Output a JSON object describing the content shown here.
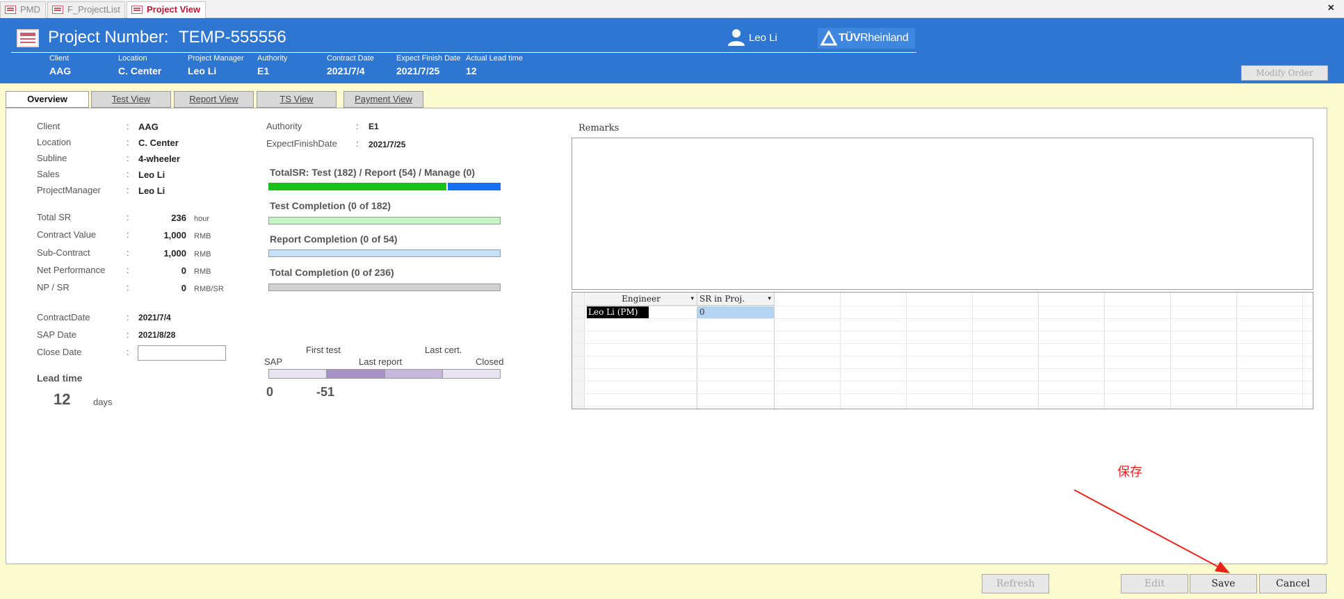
{
  "doc_tabs": [
    {
      "label": "PMD",
      "active": false
    },
    {
      "label": "F_ProjectList",
      "active": false
    },
    {
      "label": "Project View",
      "active": true
    }
  ],
  "window_close": "×",
  "header": {
    "project_label": "Project Number:",
    "project_number": "TEMP-555556",
    "user_name": "Leo Li",
    "logo_text_a": "TÜV",
    "logo_text_b": "Rheinland",
    "info": [
      {
        "label": "Client",
        "value": "AAG"
      },
      {
        "label": "Location",
        "value": "C. Center"
      },
      {
        "label": "Project Manager",
        "value": "Leo Li"
      },
      {
        "label": "Authority",
        "value": "E1"
      },
      {
        "label": "Contract Date",
        "value": "2021/7/4"
      },
      {
        "label": "Expect Finish Date",
        "value": "2021/7/25"
      },
      {
        "label": "Actual Lead time",
        "value": "12"
      }
    ],
    "modify_button": "Modify Order"
  },
  "view_tabs": [
    "Overview",
    "Test View",
    "Report View",
    "TS View",
    "Payment View"
  ],
  "overview": {
    "basic": [
      {
        "label": "Client",
        "value": "AAG"
      },
      {
        "label": "Location",
        "value": "C. Center"
      },
      {
        "label": "Subline",
        "value": "4-wheeler"
      },
      {
        "label": "Sales",
        "value": "Leo Li"
      },
      {
        "label": "ProjectManager",
        "value": "Leo Li"
      }
    ],
    "financial": [
      {
        "label": "Total SR",
        "value": "236",
        "unit": "hour"
      },
      {
        "label": "Contract Value",
        "value": "1,000",
        "unit": "RMB"
      },
      {
        "label": "Sub-Contract",
        "value": "1,000",
        "unit": "RMB"
      },
      {
        "label": "Net Performance",
        "value": "0",
        "unit": "RMB"
      },
      {
        "label": "NP / SR",
        "value": "0",
        "unit": "RMB/SR"
      }
    ],
    "dates": [
      {
        "label": "ContractDate",
        "value": "2021/7/4"
      },
      {
        "label": "SAP Date",
        "value": "2021/8/28"
      },
      {
        "label": "Close Date",
        "value": ""
      }
    ],
    "colon": ":",
    "lead_time_label": "Lead time",
    "lead_time_value": "12",
    "lead_time_unit": "days",
    "authority_label": "Authority",
    "authority_value": "E1",
    "expect_label": "ExpectFinishDate",
    "expect_value": "2021/7/25"
  },
  "progress": {
    "total_sr_title": "TotalSR: Test (182) / Report (54) / Manage (0)",
    "test_share": 0.771,
    "report_share": 0.229,
    "test_title": "Test Completion (0 of 182)",
    "test_fraction": 0,
    "report_title": "Report Completion (0 of 54)",
    "report_fraction": 0,
    "total_title": "Total Completion (0 of 236)",
    "total_fraction": 0,
    "colors": {
      "test": "#19c11c",
      "report": "#1a6ff0",
      "test_bg": "#c6f5c6",
      "report_bg": "#c6e0f5",
      "total_bg": "#d0d0d0"
    }
  },
  "timeline": {
    "first_test": "First test",
    "last_cert": "Last cert.",
    "sap": "SAP",
    "last_report": "Last report",
    "closed": "Closed",
    "value_a": "0",
    "value_b": "-51"
  },
  "remarks": {
    "label": "Remarks",
    "text": ""
  },
  "engineer_grid": {
    "columns": [
      "Engineer",
      "SR in Proj."
    ],
    "rows": [
      {
        "engineer": "Leo Li (PM)",
        "sr": "0"
      }
    ]
  },
  "footer": {
    "refresh": "Refresh",
    "edit": "Edit",
    "save": "Save",
    "cancel": "Cancel"
  },
  "annotation": {
    "text": "保存",
    "color": "#e8231a"
  }
}
